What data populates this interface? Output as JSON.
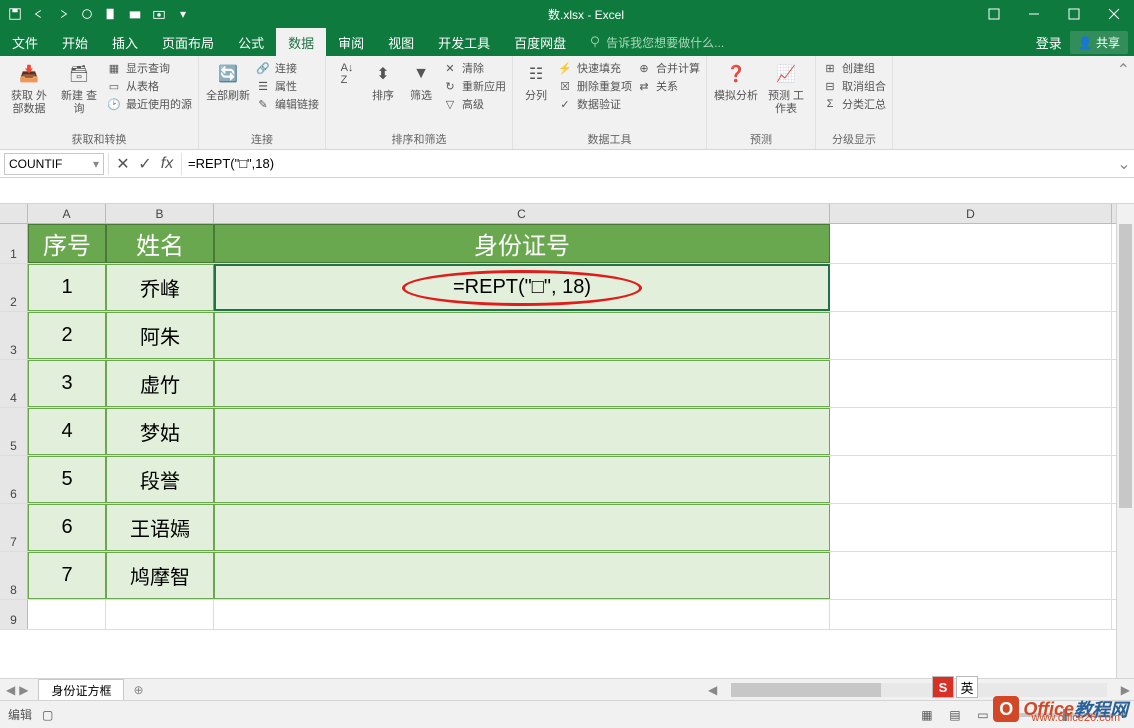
{
  "title": "数.xlsx - Excel",
  "qat_icons": [
    "save-icon",
    "undo-icon",
    "redo-icon",
    "touch-icon",
    "new-icon",
    "open-icon",
    "camera-icon",
    "dropdown-icon"
  ],
  "win": {
    "login": "登录",
    "share": "共享"
  },
  "tabs": [
    "文件",
    "开始",
    "插入",
    "页面布局",
    "公式",
    "数据",
    "审阅",
    "视图",
    "开发工具",
    "百度网盘"
  ],
  "active_tab": "数据",
  "tell_me": "告诉我您想要做什么...",
  "ribbon_groups": {
    "g1": {
      "label": "获取和转换",
      "big1": "获取\n外部数据",
      "big2": "新建\n查询",
      "s1": "显示查询",
      "s2": "从表格",
      "s3": "最近使用的源"
    },
    "g2": {
      "label": "连接",
      "big": "全部刷新",
      "s1": "连接",
      "s2": "属性",
      "s3": "编辑链接"
    },
    "g3": {
      "label": "排序和筛选",
      "b1": "A↓Z",
      "b2": "排序",
      "b3": "筛选",
      "s1": "清除",
      "s2": "重新应用",
      "s3": "高级"
    },
    "g4": {
      "label": "数据工具",
      "big": "分列",
      "s1": "快速填充",
      "s2": "删除重复项",
      "s3": "数据验证",
      "s4": "合并计算",
      "s5": "关系"
    },
    "g5": {
      "label": "预测",
      "b1": "模拟分析",
      "b2": "预测\n工作表"
    },
    "g6": {
      "label": "分级显示",
      "s1": "创建组",
      "s2": "取消组合",
      "s3": "分类汇总"
    }
  },
  "name_box": "COUNTIF",
  "formula": "=REPT(\"□\",18)",
  "columns": [
    "A",
    "B",
    "C",
    "D"
  ],
  "header_row": {
    "A": "序号",
    "B": "姓名",
    "C": "身份证号"
  },
  "data_rows": [
    {
      "n": "1",
      "name": "乔峰",
      "id": "=REPT(\"□\", 18)"
    },
    {
      "n": "2",
      "name": "阿朱",
      "id": ""
    },
    {
      "n": "3",
      "name": "虚竹",
      "id": ""
    },
    {
      "n": "4",
      "name": "梦姑",
      "id": ""
    },
    {
      "n": "5",
      "name": "段誉",
      "id": ""
    },
    {
      "n": "6",
      "name": "王语嫣",
      "id": ""
    },
    {
      "n": "7",
      "name": "鸠摩智",
      "id": ""
    }
  ],
  "sheet_tab": "身份证方框",
  "status": "编辑",
  "watermark": {
    "t1": "Office",
    "t2": "教程网",
    "url": "www.office26.com"
  },
  "ime": {
    "s": "S",
    "lang": "英"
  }
}
